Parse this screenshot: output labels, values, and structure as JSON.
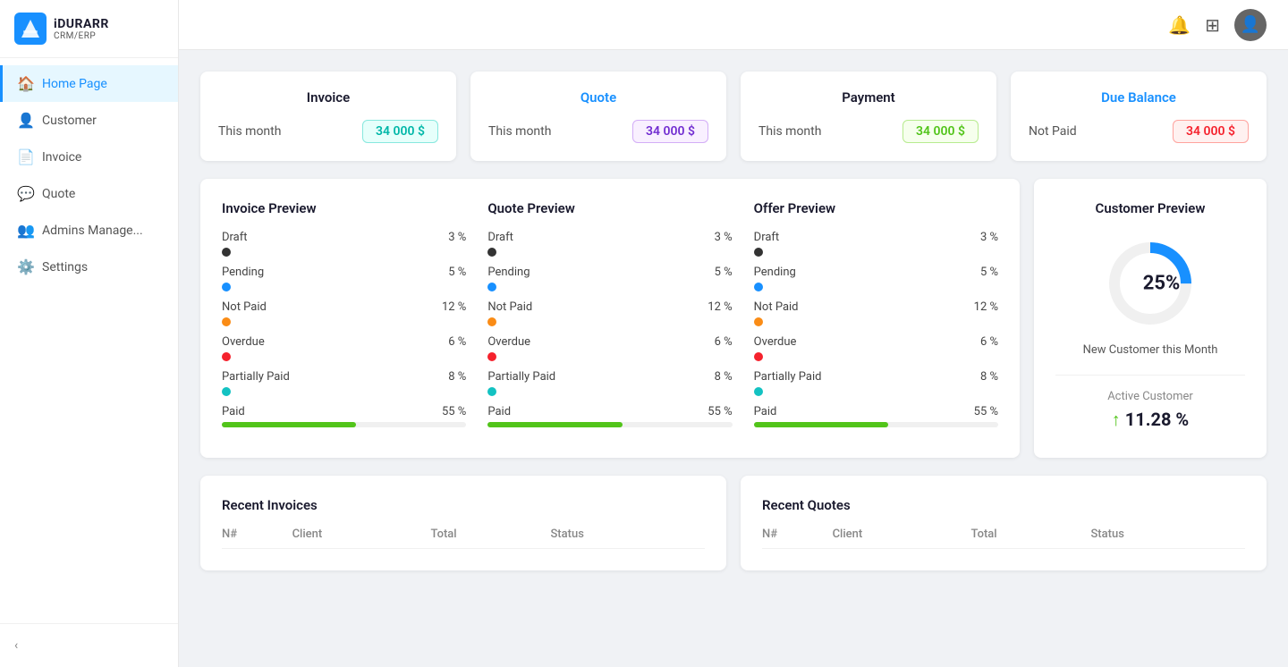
{
  "logo": {
    "name": "iDURARR",
    "sub": "CRM/ERP"
  },
  "sidebar": {
    "items": [
      {
        "id": "home",
        "label": "Home Page",
        "icon": "🏠",
        "active": true
      },
      {
        "id": "customer",
        "label": "Customer",
        "icon": "👤",
        "active": false
      },
      {
        "id": "invoice",
        "label": "Invoice",
        "icon": "📄",
        "active": false
      },
      {
        "id": "quote",
        "label": "Quote",
        "icon": "💬",
        "active": false
      },
      {
        "id": "admins",
        "label": "Admins Manage...",
        "icon": "👥",
        "active": false
      },
      {
        "id": "settings",
        "label": "Settings",
        "icon": "⚙️",
        "active": false
      }
    ],
    "collapse_label": "‹"
  },
  "stats": [
    {
      "id": "invoice",
      "title": "Invoice",
      "title_class": "normal",
      "label": "This month",
      "value": "34 000 $",
      "badge_class": "badge-cyan"
    },
    {
      "id": "quote",
      "title": "Quote",
      "title_class": "blue",
      "label": "This month",
      "value": "34 000 $",
      "badge_class": "badge-purple"
    },
    {
      "id": "payment",
      "title": "Payment",
      "title_class": "normal",
      "label": "This month",
      "value": "34 000 $",
      "badge_class": "badge-green"
    },
    {
      "id": "due",
      "title": "Due Balance",
      "title_class": "blue",
      "label": "Not Paid",
      "value": "34 000 $",
      "badge_class": "badge-red"
    }
  ],
  "preview_sections": [
    {
      "title": "Invoice Preview",
      "items": [
        {
          "label": "Draft",
          "pct": "3 %",
          "bar_class": "bar-dark",
          "dot": true,
          "width": "3"
        },
        {
          "label": "Pending",
          "pct": "5 %",
          "bar_class": "bar-blue",
          "dot": true,
          "width": "5"
        },
        {
          "label": "Not Paid",
          "pct": "12 %",
          "bar_class": "bar-orange",
          "dot": true,
          "width": "12"
        },
        {
          "label": "Overdue",
          "pct": "6 %",
          "bar_class": "bar-red",
          "dot": true,
          "width": "6"
        },
        {
          "label": "Partially Paid",
          "pct": "8 %",
          "bar_class": "bar-cyan",
          "dot": true,
          "width": "8"
        },
        {
          "label": "Paid",
          "pct": "55 %",
          "bar_class": "bar-green",
          "dot": false,
          "width": "55"
        }
      ]
    },
    {
      "title": "Quote Preview",
      "items": [
        {
          "label": "Draft",
          "pct": "3 %",
          "bar_class": "bar-dark",
          "dot": true,
          "width": "3"
        },
        {
          "label": "Pending",
          "pct": "5 %",
          "bar_class": "bar-blue",
          "dot": true,
          "width": "5"
        },
        {
          "label": "Not Paid",
          "pct": "12 %",
          "bar_class": "bar-orange",
          "dot": true,
          "width": "12"
        },
        {
          "label": "Overdue",
          "pct": "6 %",
          "bar_class": "bar-red",
          "dot": true,
          "width": "6"
        },
        {
          "label": "Partially Paid",
          "pct": "8 %",
          "bar_class": "bar-cyan",
          "dot": true,
          "width": "8"
        },
        {
          "label": "Paid",
          "pct": "55 %",
          "bar_class": "bar-green",
          "dot": false,
          "width": "55"
        }
      ]
    },
    {
      "title": "Offer Preview",
      "items": [
        {
          "label": "Draft",
          "pct": "3 %",
          "bar_class": "bar-dark",
          "dot": true,
          "width": "3"
        },
        {
          "label": "Pending",
          "pct": "5 %",
          "bar_class": "bar-blue",
          "dot": true,
          "width": "5"
        },
        {
          "label": "Not Paid",
          "pct": "12 %",
          "bar_class": "bar-orange",
          "dot": true,
          "width": "12"
        },
        {
          "label": "Overdue",
          "pct": "6 %",
          "bar_class": "bar-red",
          "dot": true,
          "width": "6"
        },
        {
          "label": "Partially Paid",
          "pct": "8 %",
          "bar_class": "bar-cyan",
          "dot": true,
          "width": "8"
        },
        {
          "label": "Paid",
          "pct": "55 %",
          "bar_class": "bar-green",
          "dot": false,
          "width": "55"
        }
      ]
    }
  ],
  "customer_preview": {
    "title": "Customer Preview",
    "percentage": "25%",
    "new_customer_label": "New Customer this Month",
    "active_label": "Active Customer",
    "active_pct": "↑ 11.28 %"
  },
  "recent_invoices": {
    "title": "Recent Invoices",
    "columns": [
      "N#",
      "Client",
      "Total",
      "Status"
    ]
  },
  "recent_quotes": {
    "title": "Recent Quotes",
    "columns": [
      "N#",
      "Client",
      "Total",
      "Status"
    ]
  }
}
